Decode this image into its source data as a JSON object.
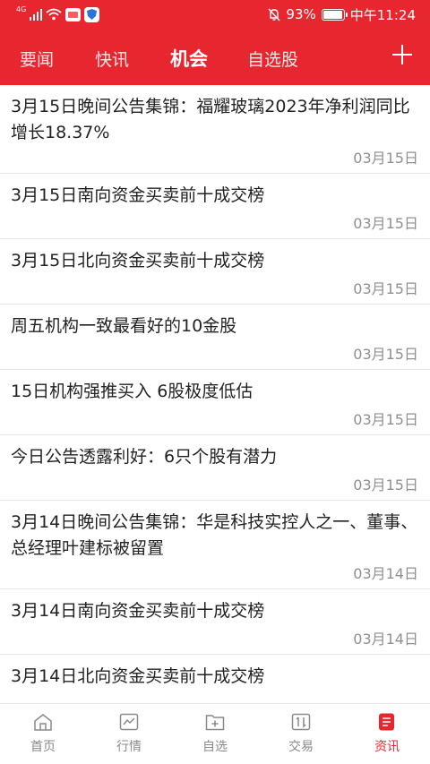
{
  "status_bar": {
    "network": "4G",
    "battery": "93%",
    "time": "中午11:24"
  },
  "tabs": [
    {
      "label": "要闻"
    },
    {
      "label": "快讯"
    },
    {
      "label": "机会"
    },
    {
      "label": "自选股"
    }
  ],
  "active_tab": "机会",
  "news": [
    {
      "title": "3月15日晚间公告集锦：福耀玻璃2023年净利润同比增长18.37%",
      "date": "03月15日"
    },
    {
      "title": "3月15日南向资金买卖前十成交榜",
      "date": "03月15日"
    },
    {
      "title": "3月15日北向资金买卖前十成交榜",
      "date": "03月15日"
    },
    {
      "title": "周五机构一致最看好的10金股",
      "date": "03月15日"
    },
    {
      "title": "15日机构强推买入 6股极度低估",
      "date": "03月15日"
    },
    {
      "title": "今日公告透露利好：6只个股有潜力",
      "date": "03月15日"
    },
    {
      "title": "3月14日晚间公告集锦：华是科技实控人之一、董事、总经理叶建标被留置",
      "date": "03月14日"
    },
    {
      "title": "3月14日南向资金买卖前十成交榜",
      "date": "03月14日"
    },
    {
      "title": "3月14日北向资金买卖前十成交榜",
      "date": ""
    }
  ],
  "bottom_nav": [
    {
      "label": "首页",
      "icon": "home-icon"
    },
    {
      "label": "行情",
      "icon": "market-chart-icon"
    },
    {
      "label": "自选",
      "icon": "watchlist-folder-icon"
    },
    {
      "label": "交易",
      "icon": "trade-icon"
    },
    {
      "label": "资讯",
      "icon": "news-icon"
    }
  ],
  "active_nav": "资讯",
  "colors": {
    "brand_red": "#e8262f",
    "date_gray": "#8f8f8f",
    "nav_gray": "#8a8a8a"
  }
}
